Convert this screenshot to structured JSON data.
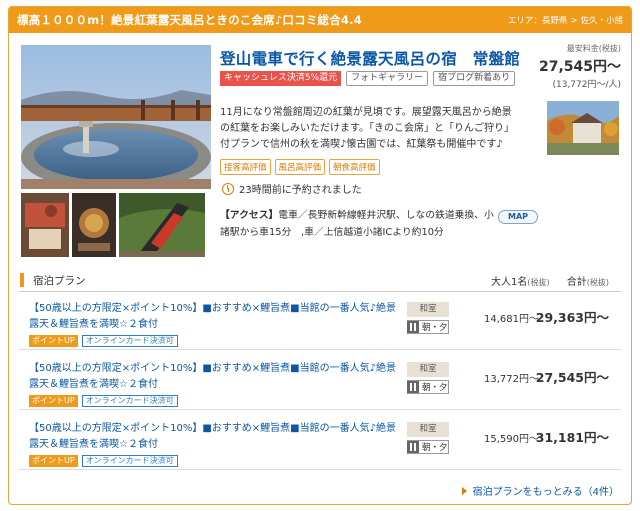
{
  "header": {
    "title": "標高１０００m！絶景紅葉露天風呂ときのこ会席♪口コミ総合4.4",
    "area_label": "エリア：",
    "area_pref": "長野県",
    "area_sep": ">",
    "area_city": "佐久・小諸"
  },
  "hotel": {
    "name": "登山電車で行く絶景露天風呂の宿　常盤館",
    "badges": {
      "cashless": "キャッシュレス決済5%還元",
      "gallery": "フォトギャラリー",
      "blog": "宿ブログ新着あり"
    },
    "price": {
      "label": "最安料金(税抜)",
      "main": "27,545円〜",
      "per_person": "(13,772円〜/人)"
    },
    "description": "11月になり常盤館周辺の紅葉が見頃です。展望露天風呂から絶景の紅葉をお楽しみいただけます。「きのこ会席」と「りんご狩り」付プランで信州の秋を満喫♪懐古園では、紅葉祭も開催中です♪",
    "evaluations": [
      "接客高評価",
      "風呂高評価",
      "朝食高評価"
    ],
    "booked": "23時間前に予約されました",
    "access_label": "【アクセス】",
    "access": "電車／長野新幹線軽井沢駅、しなの鉄道乗換、小諸駅から車15分　,車／上信越道小諸ICより約10分",
    "map_button": "MAP"
  },
  "plans": {
    "section_title": "宿泊プラン",
    "col_per_person": "大人1名",
    "col_total": "合計",
    "tax_note": "(税抜)",
    "items": [
      {
        "title": "【50歳以上の方限定×ポイント10%】■おすすめ×鯉旨煮■当館の一番人気♪絶景露天＆鯉旨煮を満喫☆２食付",
        "tag_point": "ポイントUP",
        "tag_card": "オンラインカード決済可",
        "room": "和室",
        "meal": "朝・夕",
        "per_person": "14,681円〜",
        "total": "29,363円〜"
      },
      {
        "title": "【50歳以上の方限定×ポイント10%】■おすすめ×鯉旨煮■当館の一番人気♪絶景露天＆鯉旨煮を満喫☆２食付",
        "tag_point": "ポイントUP",
        "tag_card": "オンラインカード決済可",
        "room": "和室",
        "meal": "朝・夕",
        "per_person": "13,772円〜",
        "total": "27,545円〜"
      },
      {
        "title": "【50歳以上の方限定×ポイント10%】■おすすめ×鯉旨煮■当館の一番人気♪絶景露天＆鯉旨煮を満喫☆２食付",
        "tag_point": "ポイントUP",
        "tag_card": "オンラインカード決済可",
        "room": "和室",
        "meal": "朝・夕",
        "per_person": "15,590円〜",
        "total": "31,181円〜"
      }
    ],
    "more_link": "宿泊プランをもっとみる（4件）"
  }
}
